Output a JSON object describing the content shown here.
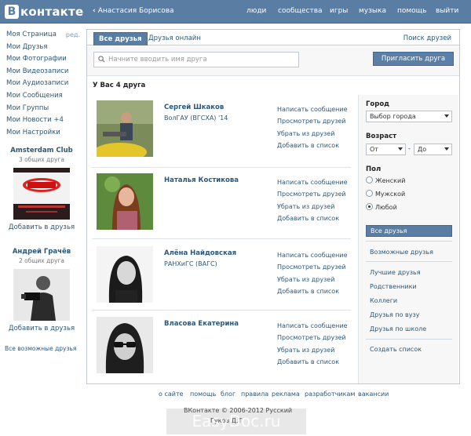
{
  "header": {
    "logo_letter": "В",
    "logo_text": "контакте",
    "back_chevron": "‹",
    "back_text": "Анастасия Борисова",
    "nav": [
      "люди",
      "сообщества",
      "игры",
      "музыка",
      "помощь",
      "выйти"
    ]
  },
  "left_menu": {
    "items": [
      "Моя Страница",
      "Мои Друзья",
      "Мои Фотографии",
      "Мои Видеозаписи",
      "Мои Аудиозаписи",
      "Мои Сообщения",
      "Мои Группы",
      "Мои Новости +4",
      "Мои Настройки"
    ],
    "edit": "ред."
  },
  "suggestions": [
    {
      "title": "Amsterdam Club",
      "common": "3 общих друга",
      "add": "Добавить в друзья"
    },
    {
      "title": "Андрей Грачёв",
      "common": "2 общих друга",
      "add": "Добавить в друзья"
    }
  ],
  "all_possible": "Все возможные друзья",
  "tabs": {
    "all": "Все друзья",
    "online": "Друзья онлайн",
    "search": "Поиск друзей"
  },
  "search": {
    "placeholder": "Начните вводить имя друга",
    "invite": "Пригласить друга"
  },
  "count_label": "У Вас 4 друга",
  "friends": [
    {
      "name": "Сергей Шкаков",
      "university": "ВолГАУ (ВГСХА) '14"
    },
    {
      "name": "Наталья Костикова",
      "university": ""
    },
    {
      "name": "Алёна Найдовская",
      "university": "РАНХиГС (ВАГС)"
    },
    {
      "name": "Власова Екатерина",
      "university": ""
    }
  ],
  "friend_actions": [
    "Написать сообщение",
    "Просмотреть друзей",
    "Убрать из друзей",
    "Добавить в список"
  ],
  "filter": {
    "city_label": "Город",
    "city_value": "Выбор города",
    "age_label": "Возраст",
    "age_from": "От",
    "age_dash": "-",
    "age_to": "До",
    "sex_label": "Пол",
    "sex_options": [
      "Женский",
      "Мужской",
      "Любой"
    ],
    "sex_selected": "Любой"
  },
  "categories": {
    "active": "Все друзья",
    "possible": "Возможные друзья",
    "lists": [
      "Лучшие друзья",
      "Родственники",
      "Коллеги",
      "Друзья по вузу",
      "Друзья по школе"
    ],
    "create": "Создать список"
  },
  "footer": {
    "links": [
      "о сайте",
      "помощь",
      "блог",
      "правила",
      "реклама",
      "разработчикам",
      "вакансии"
    ],
    "copyright": "ВКонтакте © 2006-2012 Русский",
    "copyright2": "Гуков Д.Т"
  },
  "watermark": "EasyDoc.ru",
  "colors": {
    "header": "#597da3",
    "link": "#2b587a",
    "button": "#5b7fa6"
  }
}
